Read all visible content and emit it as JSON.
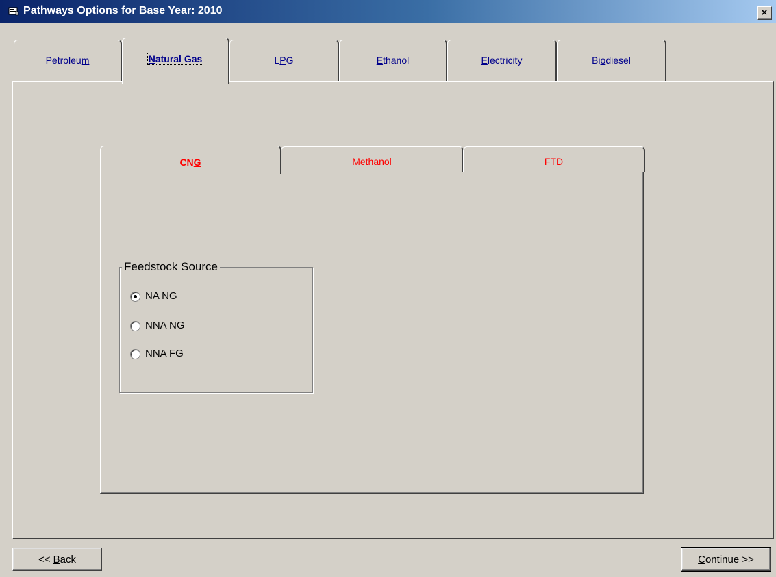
{
  "window": {
    "title": "Pathways Options for Base Year: 2010",
    "close_label": "×"
  },
  "outer_tabs": [
    {
      "pre": "Petroleu",
      "u": "m",
      "post": "",
      "selected": false
    },
    {
      "pre": "",
      "u": "N",
      "post": "atural Gas",
      "selected": true
    },
    {
      "pre": "L",
      "u": "P",
      "post": "G",
      "selected": false
    },
    {
      "pre": "",
      "u": "E",
      "post": "thanol",
      "selected": false
    },
    {
      "pre": "",
      "u": "E",
      "post": "lectricity",
      "selected": false
    },
    {
      "pre": "Bi",
      "u": "o",
      "post": "diesel",
      "selected": false
    }
  ],
  "inner_tabs": [
    {
      "pre": "CN",
      "u": "G",
      "post": "",
      "selected": true
    },
    {
      "pre": "Methanol",
      "u": "",
      "post": "",
      "selected": false
    },
    {
      "pre": "FTD",
      "u": "",
      "post": "",
      "selected": false
    }
  ],
  "feedstock": {
    "legend": "Feedstock Source",
    "options": [
      {
        "label": "NA NG",
        "checked": true
      },
      {
        "label": "NNA NG",
        "checked": false
      },
      {
        "label": "NNA FG",
        "checked": false
      }
    ]
  },
  "buttons": {
    "back_pre": "<< ",
    "back_u": "B",
    "back_post": "ack",
    "continue_pre": "",
    "continue_u": "C",
    "continue_post": "ontinue >>"
  },
  "colors": {
    "title_bar_start": "#0a246a",
    "title_bar_end": "#a6caf0",
    "face": "#d4d0c8",
    "outer_tab_text": "#00008b",
    "inner_tab_text": "#ff0000"
  }
}
